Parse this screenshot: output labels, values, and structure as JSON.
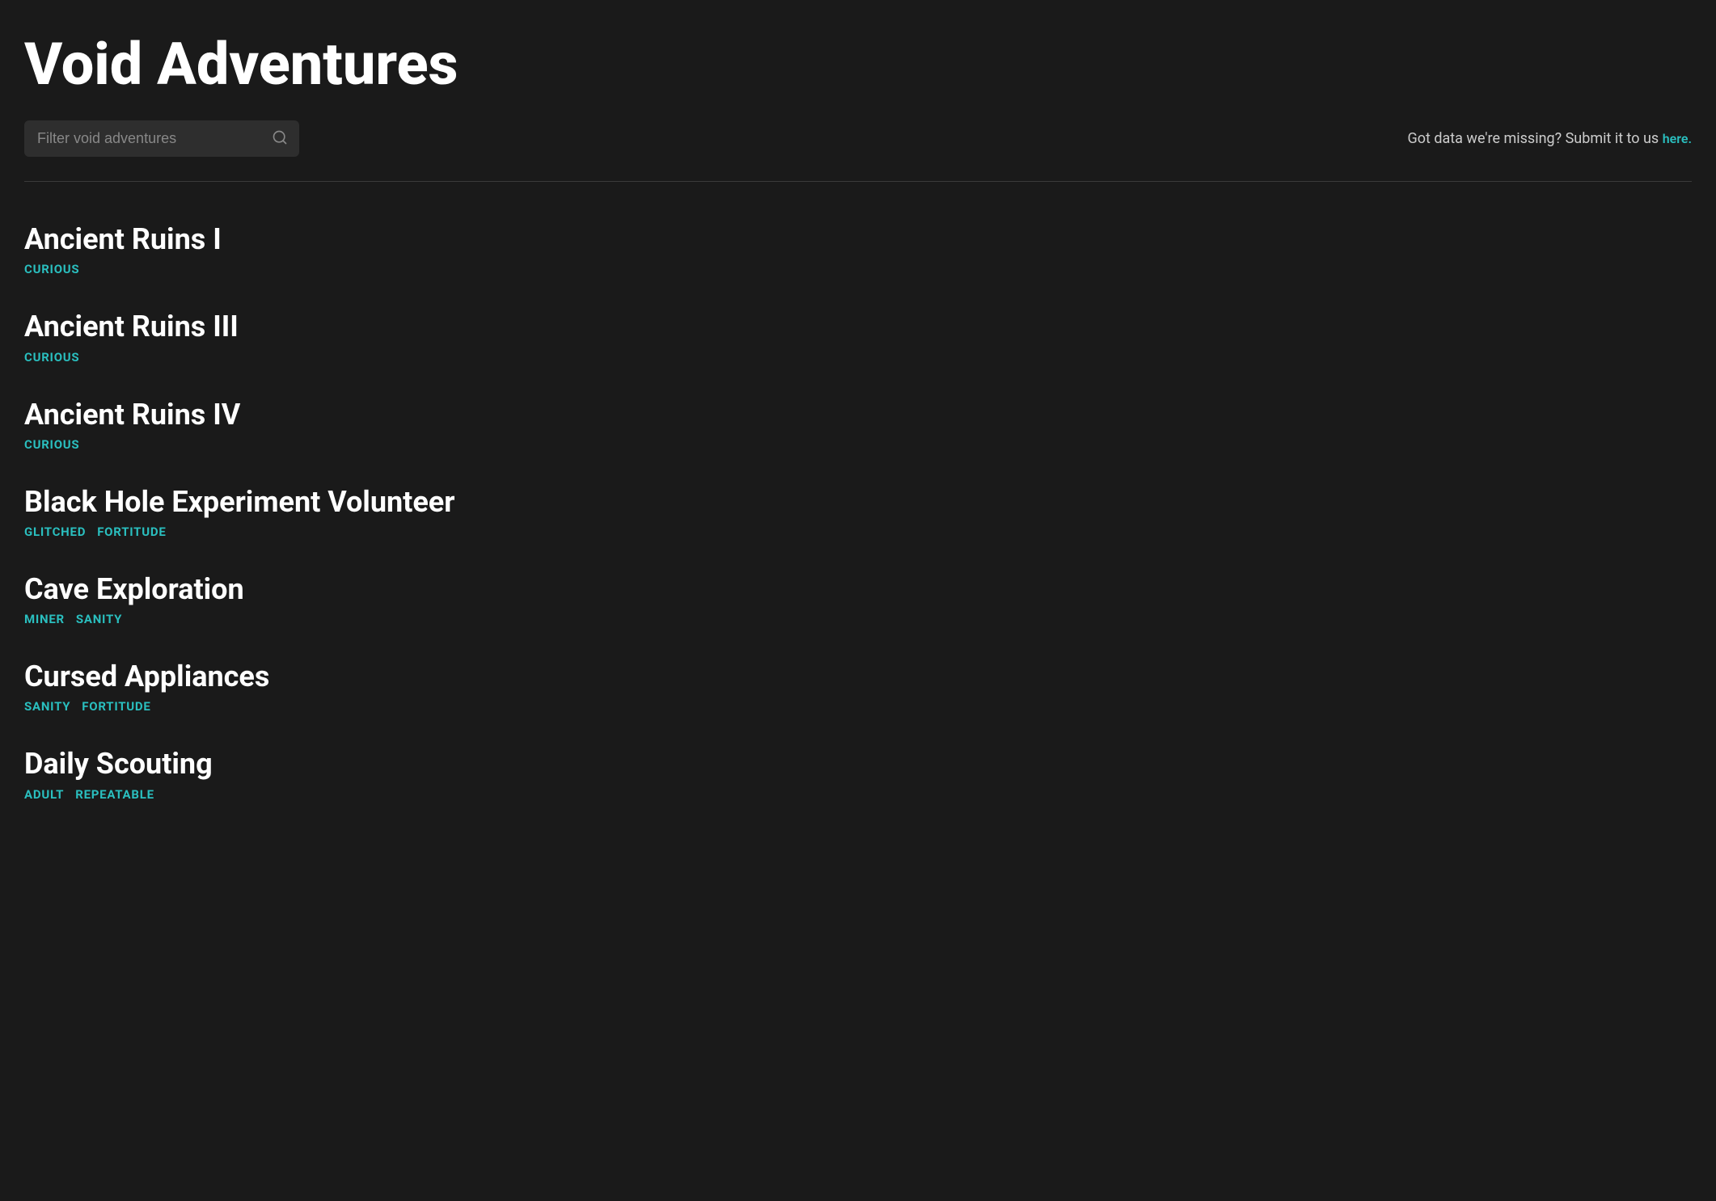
{
  "header": {
    "title": "Void Adventures",
    "search": {
      "placeholder": "Filter void adventures"
    },
    "submit_text": "Got data we're missing? Submit it to us ",
    "submit_link_label": "here.",
    "submit_link_href": "#"
  },
  "adventures": [
    {
      "name": "Ancient Ruins I",
      "tags": [
        "CURIOUS"
      ]
    },
    {
      "name": "Ancient Ruins III",
      "tags": [
        "CURIOUS"
      ]
    },
    {
      "name": "Ancient Ruins IV",
      "tags": [
        "CURIOUS"
      ]
    },
    {
      "name": "Black Hole Experiment Volunteer",
      "tags": [
        "GLITCHED",
        "FORTITUDE"
      ]
    },
    {
      "name": "Cave Exploration",
      "tags": [
        "MINER",
        "SANITY"
      ]
    },
    {
      "name": "Cursed Appliances",
      "tags": [
        "SANITY",
        "FORTITUDE"
      ]
    },
    {
      "name": "Daily Scouting",
      "tags": [
        "ADULT",
        "REPEATABLE"
      ]
    }
  ]
}
